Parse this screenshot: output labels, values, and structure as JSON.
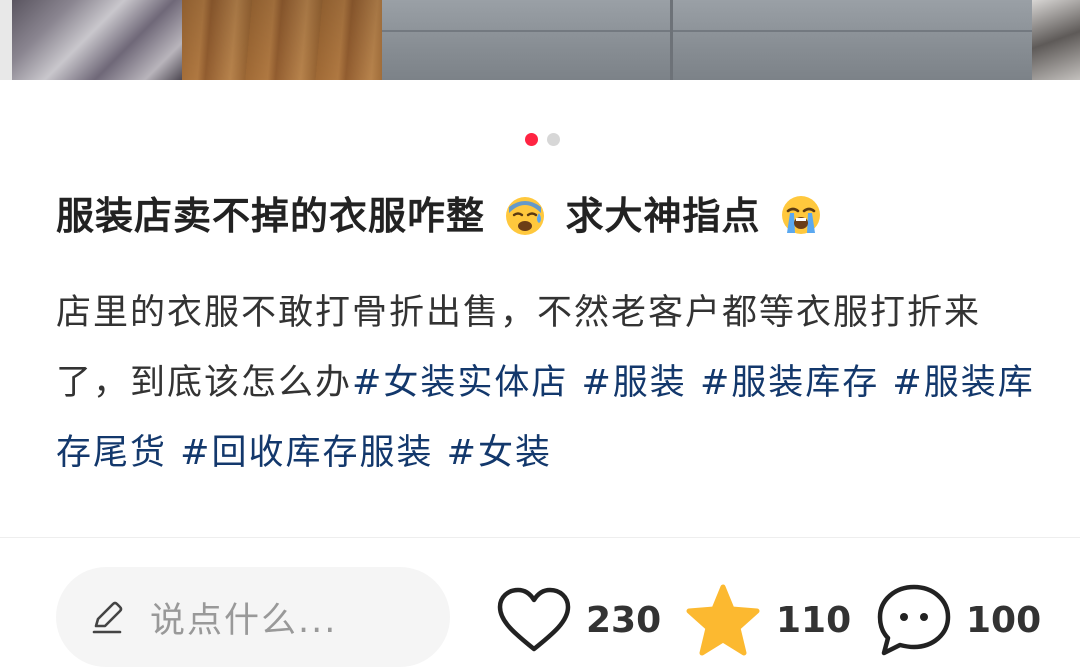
{
  "carousel": {
    "dot_count": 2,
    "active_index": 0,
    "active_color": "#ff2442"
  },
  "post": {
    "title_part1": "服装店卖不掉的衣服咋整",
    "title_emoji1": "sad-sweat-face-emoji",
    "title_part2": "求大神指点",
    "title_emoji2": "loudly-crying-face-emoji",
    "body_text": "店里的衣服不敢打骨折出售，不然老客户都等衣服打折来了，到底该怎么办",
    "tags": [
      "#女装实体店",
      "#服装",
      "#服装库存",
      "#服装库存尾货",
      "#回收库存服装",
      "#女装"
    ]
  },
  "bottom_bar": {
    "comment_placeholder": "说点什么...",
    "pencil_icon": "pencil-icon",
    "likes": "230",
    "likes_icon": "heart-icon",
    "collects": "110",
    "collects_icon": "star-icon",
    "comments": "100",
    "comments_icon": "comment-bubble-icon",
    "star_color": "#fcb930"
  }
}
